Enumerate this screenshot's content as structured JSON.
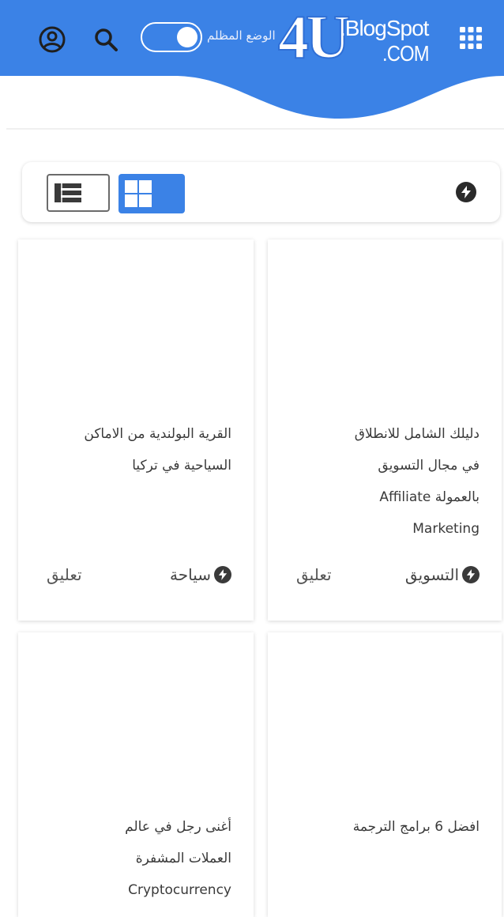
{
  "header": {
    "logo_main": "4U",
    "logo_blog": ".BlogSpot",
    "logo_com": ".COM",
    "dark_mode_label": "الوضع المظلم",
    "dark_mode_on": false,
    "accent": "#3b82e6"
  },
  "icons": {
    "account": "account-circle-icon",
    "search": "search-icon",
    "apps": "apps-grid-icon",
    "bolt": "bolt-icon",
    "list_view": "list-view-icon",
    "grid_view": "grid-view-icon"
  },
  "posts": [
    {
      "title_lines": [
        "دليلك الشامل للانطلاق",
        "في مجال التسويق",
        "بالعمولة Affiliate",
        "Marketing"
      ],
      "category": "التسويق",
      "comment_label": "تعليق"
    },
    {
      "title_lines": [
        "القرية البولندية من الاماكن",
        "السياحية في تركيا"
      ],
      "category": "سياحة",
      "comment_label": "تعليق"
    },
    {
      "title_lines": [
        "افضل 6 برامج الترجمة"
      ],
      "category": "",
      "comment_label": ""
    },
    {
      "title_lines": [
        "أغنى رجل في عالم",
        "العملات المشفرة",
        "Cryptocurrency"
      ],
      "category": "",
      "comment_label": ""
    }
  ]
}
